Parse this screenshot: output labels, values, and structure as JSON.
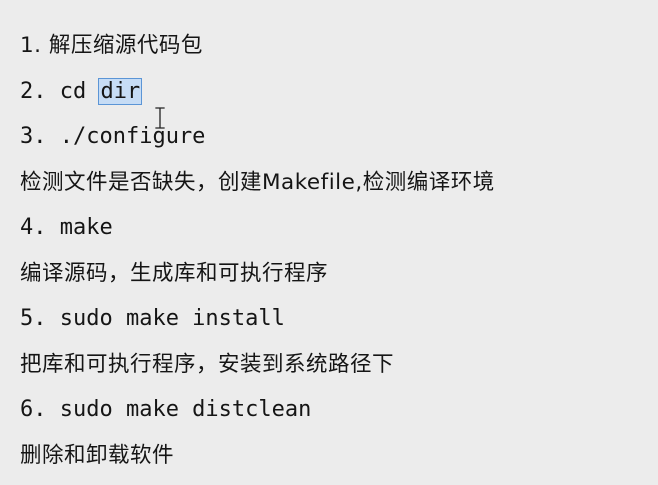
{
  "lines": [
    {
      "id": "step-1",
      "text": "1. 解压缩源代码包"
    },
    {
      "id": "step-2",
      "prefix": "2. cd ",
      "selected": "dir"
    },
    {
      "id": "step-3",
      "text": "3. ./configure"
    },
    {
      "id": "desc-3",
      "text": "检测文件是否缺失，创建Makefile,检测编译环境"
    },
    {
      "id": "step-4",
      "text": "4. make"
    },
    {
      "id": "desc-4",
      "text": "编译源码，生成库和可执行程序"
    },
    {
      "id": "step-5",
      "text": "5. sudo make install"
    },
    {
      "id": "desc-5",
      "text": "把库和可执行程序，安装到系统路径下"
    },
    {
      "id": "step-6",
      "text": "6. sudo make distclean"
    },
    {
      "id": "desc-6",
      "text": "删除和卸载软件"
    }
  ],
  "icons": {
    "cursor": "text-ibeam-cursor-icon"
  }
}
